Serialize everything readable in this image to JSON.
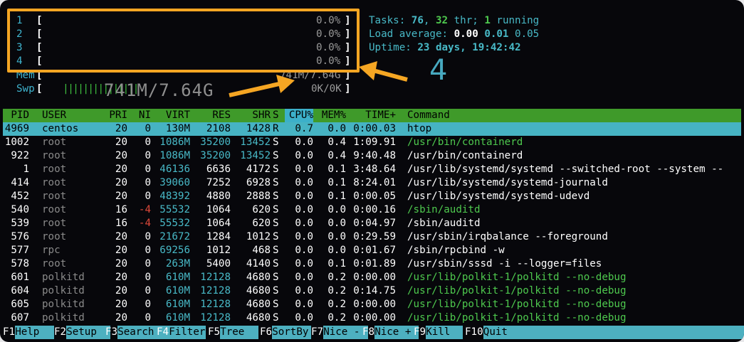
{
  "colors": {
    "accent": "#f5a623",
    "header_bg": "#3f9a2a",
    "selected_bg": "#46b3c3",
    "sort_col": "#3cb0c9"
  },
  "cpus": [
    {
      "num": "1",
      "open": "[",
      "pct": "0.0%",
      "close": "]"
    },
    {
      "num": "2",
      "open": "[",
      "pct": "0.0%",
      "close": "]"
    },
    {
      "num": "3",
      "open": "[",
      "pct": "0.0%",
      "close": "]"
    },
    {
      "num": "4",
      "open": "[",
      "pct": "0.0%",
      "close": "]"
    }
  ],
  "mem": {
    "label": "Mem",
    "open": "[",
    "bars": "|||||||||||||||",
    "value": "741M/7.64G",
    "close": "]"
  },
  "swp": {
    "label": "Swp",
    "open": "[",
    "value": "0K/0K",
    "close": "]"
  },
  "stats": {
    "tasks_label": "Tasks: ",
    "tasks": "76",
    "sep1": ", ",
    "thr": "32",
    "thr_label": " thr; ",
    "running": "1",
    "running_label": " running",
    "load_label": "Load average: ",
    "load1": "0.00",
    "load5": "0.01",
    "load15": "0.05",
    "uptime_label": "Uptime: ",
    "uptime": "23 days, 19:42:42"
  },
  "annotations": {
    "big_mem": "741M/7.64G",
    "big_num": "4"
  },
  "columns": [
    "PID",
    "USER",
    "PRI",
    "NI",
    "VIRT",
    "RES",
    "SHR",
    "S",
    "CPU%",
    "MEM%",
    "TIME+",
    "Command"
  ],
  "processes": [
    {
      "pid": "4969",
      "user": "centos",
      "pri": "20",
      "ni": "0",
      "virt": "130M",
      "res": "2108",
      "shr": "1428",
      "s": "R",
      "cpu": "0.7",
      "mem": "0.0",
      "time": "0:00.03",
      "cmd": "htop"
    },
    {
      "pid": "1002",
      "user": "root",
      "pri": "20",
      "ni": "0",
      "virt": "1086M",
      "res": "35200",
      "shr": "13452",
      "s": "S",
      "cpu": "0.0",
      "mem": "0.4",
      "time": "1:09.91",
      "cmd": "/usr/bin/containerd"
    },
    {
      "pid": "922",
      "user": "root",
      "pri": "20",
      "ni": "0",
      "virt": "1086M",
      "res": "35200",
      "shr": "13452",
      "s": "S",
      "cpu": "0.0",
      "mem": "0.4",
      "time": "9:40.48",
      "cmd": "/usr/bin/containerd"
    },
    {
      "pid": "1",
      "user": "root",
      "pri": "20",
      "ni": "0",
      "virt": "46136",
      "res": "6636",
      "shr": "4172",
      "s": "S",
      "cpu": "0.0",
      "mem": "0.1",
      "time": "3:48.64",
      "cmd": "/usr/lib/systemd/systemd --switched-root --system --"
    },
    {
      "pid": "414",
      "user": "root",
      "pri": "20",
      "ni": "0",
      "virt": "39060",
      "res": "7252",
      "shr": "6928",
      "s": "S",
      "cpu": "0.0",
      "mem": "0.1",
      "time": "8:24.01",
      "cmd": "/usr/lib/systemd/systemd-journald"
    },
    {
      "pid": "452",
      "user": "root",
      "pri": "20",
      "ni": "0",
      "virt": "48392",
      "res": "4880",
      "shr": "2888",
      "s": "S",
      "cpu": "0.0",
      "mem": "0.1",
      "time": "0:00.05",
      "cmd": "/usr/lib/systemd/systemd-udevd"
    },
    {
      "pid": "540",
      "user": "root",
      "pri": "16",
      "ni": "-4",
      "virt": "55532",
      "res": "1064",
      "shr": "620",
      "s": "S",
      "cpu": "0.0",
      "mem": "0.0",
      "time": "0:00.16",
      "cmd": "/sbin/auditd"
    },
    {
      "pid": "539",
      "user": "root",
      "pri": "16",
      "ni": "-4",
      "virt": "55532",
      "res": "1064",
      "shr": "620",
      "s": "S",
      "cpu": "0.0",
      "mem": "0.0",
      "time": "0:04.97",
      "cmd": "/sbin/auditd"
    },
    {
      "pid": "576",
      "user": "root",
      "pri": "20",
      "ni": "0",
      "virt": "21672",
      "res": "1284",
      "shr": "1012",
      "s": "S",
      "cpu": "0.0",
      "mem": "0.0",
      "time": "0:29.59",
      "cmd": "/usr/sbin/irqbalance --foreground"
    },
    {
      "pid": "577",
      "user": "rpc",
      "pri": "20",
      "ni": "0",
      "virt": "69256",
      "res": "1012",
      "shr": "468",
      "s": "S",
      "cpu": "0.0",
      "mem": "0.0",
      "time": "0:01.67",
      "cmd": "/sbin/rpcbind -w"
    },
    {
      "pid": "578",
      "user": "root",
      "pri": "20",
      "ni": "0",
      "virt": "263M",
      "res": "5400",
      "shr": "4140",
      "s": "S",
      "cpu": "0.0",
      "mem": "0.1",
      "time": "0:01.89",
      "cmd": "/usr/sbin/sssd -i --logger=files"
    },
    {
      "pid": "601",
      "user": "polkitd",
      "pri": "20",
      "ni": "0",
      "virt": "610M",
      "res": "12128",
      "shr": "4680",
      "s": "S",
      "cpu": "0.0",
      "mem": "0.2",
      "time": "0:00.00",
      "cmd": "/usr/lib/polkit-1/polkitd --no-debug"
    },
    {
      "pid": "604",
      "user": "polkitd",
      "pri": "20",
      "ni": "0",
      "virt": "610M",
      "res": "12128",
      "shr": "4680",
      "s": "S",
      "cpu": "0.0",
      "mem": "0.2",
      "time": "0:14.75",
      "cmd": "/usr/lib/polkit-1/polkitd --no-debug"
    },
    {
      "pid": "605",
      "user": "polkitd",
      "pri": "20",
      "ni": "0",
      "virt": "610M",
      "res": "12128",
      "shr": "4680",
      "s": "S",
      "cpu": "0.0",
      "mem": "0.2",
      "time": "0:00.00",
      "cmd": "/usr/lib/polkit-1/polkitd --no-debug"
    },
    {
      "pid": "607",
      "user": "polkitd",
      "pri": "20",
      "ni": "0",
      "virt": "610M",
      "res": "12128",
      "shr": "4680",
      "s": "S",
      "cpu": "0.0",
      "mem": "0.2",
      "time": "0:00.00",
      "cmd": "/usr/lib/polkit-1/polkitd --no-debug"
    }
  ],
  "fkeys": [
    {
      "key": "F1",
      "label": "Help"
    },
    {
      "key": "F2",
      "label": "Setup"
    },
    {
      "key": "F3",
      "label": "Search"
    },
    {
      "key": "F4",
      "label": "Filter"
    },
    {
      "key": "F5",
      "label": "Tree"
    },
    {
      "key": "F6",
      "label": "SortBy"
    },
    {
      "key": "F7",
      "label": "Nice -"
    },
    {
      "key": "F8",
      "label": "Nice +"
    },
    {
      "key": "F9",
      "label": "Kill"
    },
    {
      "key": "F10",
      "label": "Quit"
    }
  ]
}
